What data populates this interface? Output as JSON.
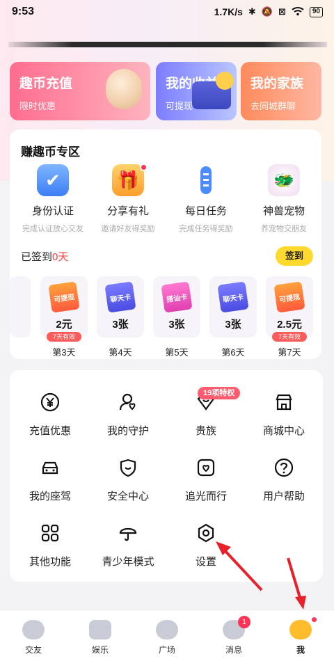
{
  "status_bar": {
    "time": "9:53",
    "network_speed": "1.7K/s",
    "battery": "90"
  },
  "cards": [
    {
      "title": "趣币充值",
      "subtitle": "限时优惠",
      "color": "#ff6d8d"
    },
    {
      "title": "我的收益",
      "subtitle": "可提现",
      "color": "#7c7dff"
    },
    {
      "title": "我的家族",
      "subtitle": "去同城群聊",
      "color": "#ff8a5c"
    }
  ],
  "earn_section": {
    "title": "赚趣币专区",
    "items": [
      {
        "name": "身份认证",
        "desc": "完成认证放心交友",
        "icon": "shield-check-icon"
      },
      {
        "name": "分享有礼",
        "desc": "邀请好友得奖励",
        "icon": "gift-box-icon"
      },
      {
        "name": "每日任务",
        "desc": "完成任务得奖励",
        "icon": "task-tube-icon"
      },
      {
        "name": "神兽宠物",
        "desc": "养宠物交朋友",
        "icon": "pet-beast-icon"
      }
    ]
  },
  "checkin": {
    "prefix": "已签到",
    "days": "0天",
    "button": "签到",
    "days_list": [
      {
        "value": "2元",
        "badge": "7天有效",
        "label": "第3天",
        "card": "可提现"
      },
      {
        "value": "3张",
        "badge": "",
        "label": "第4天",
        "card": "聊天卡"
      },
      {
        "value": "3张",
        "badge": "",
        "label": "第5天",
        "card": "搭讪卡"
      },
      {
        "value": "3张",
        "badge": "",
        "label": "第6天",
        "card": "聊天卡"
      },
      {
        "value": "2.5元",
        "badge": "7天有效",
        "label": "第7天",
        "card": "可提现"
      }
    ]
  },
  "menu": {
    "items": [
      {
        "label": "充值优惠",
        "icon": "yen-icon"
      },
      {
        "label": "我的守护",
        "icon": "guard-user-icon"
      },
      {
        "label": "贵族",
        "icon": "heart-shield-icon"
      },
      {
        "label": "商城中心",
        "icon": "store-icon"
      },
      {
        "label": "我的座驾",
        "icon": "car-icon"
      },
      {
        "label": "安全中心",
        "icon": "shield-icon"
      },
      {
        "label": "追光而行",
        "icon": "photo-heart-icon"
      },
      {
        "label": "用户帮助",
        "icon": "help-icon"
      },
      {
        "label": "其他功能",
        "icon": "grid-icon"
      },
      {
        "label": "青少年模式",
        "icon": "umbrella-icon"
      },
      {
        "label": "设置",
        "icon": "settings-hex-icon"
      }
    ],
    "vip_badge": "19项特权"
  },
  "tabbar": [
    {
      "label": "交友",
      "icon": "heart-icon"
    },
    {
      "label": "娱乐",
      "icon": "video-icon"
    },
    {
      "label": "广场",
      "icon": "planet-icon"
    },
    {
      "label": "消息",
      "icon": "chat-icon",
      "badge": "1"
    },
    {
      "label": "我",
      "icon": "avatar-icon"
    }
  ]
}
